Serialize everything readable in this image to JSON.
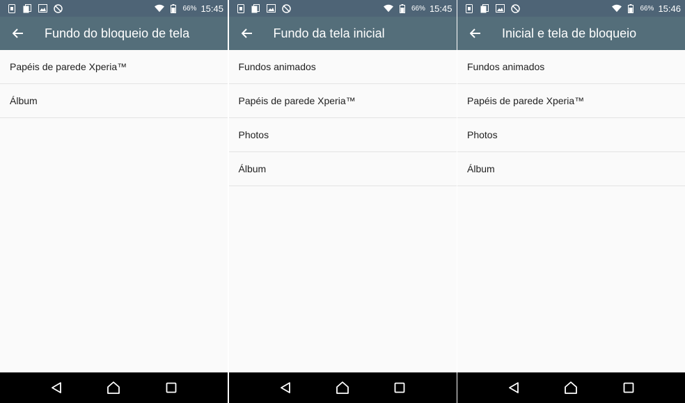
{
  "screens": [
    {
      "status": {
        "battery": "66%",
        "time": "15:45"
      },
      "title": "Fundo do bloqueio de tela",
      "items": [
        "Papéis de parede Xperia™",
        "Álbum"
      ]
    },
    {
      "status": {
        "battery": "66%",
        "time": "15:45"
      },
      "title": "Fundo da tela inicial",
      "items": [
        "Fundos animados",
        "Papéis de parede Xperia™",
        "Photos",
        "Álbum"
      ]
    },
    {
      "status": {
        "battery": "66%",
        "time": "15:46"
      },
      "title": "Inicial e tela de bloqueio",
      "items": [
        "Fundos animados",
        "Papéis de parede Xperia™",
        "Photos",
        "Álbum"
      ]
    }
  ],
  "icons": {
    "status_left": [
      "sim-card-icon",
      "documents-icon",
      "image-icon",
      "sync-off-icon"
    ],
    "status_right": [
      "wifi-icon",
      "battery-icon"
    ],
    "app_bar": "back-arrow-icon",
    "nav": [
      "back-triangle-icon",
      "home-icon",
      "recents-icon"
    ]
  },
  "colors": {
    "status_bar": "#4e6476",
    "app_bar": "#546e7a",
    "background": "#fafafa",
    "divider": "#e3e3e3",
    "nav_bar": "#000000"
  }
}
